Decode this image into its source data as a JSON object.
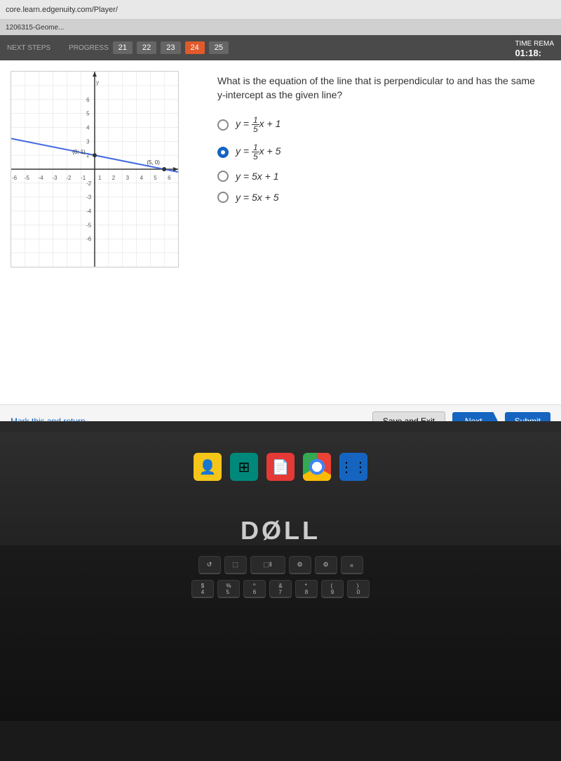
{
  "browser": {
    "url": "core.learn.edgenuity.com/Player/",
    "tab": "1206315-Geome..."
  },
  "header": {
    "nav_label": "NEXT STEPS",
    "progress_label": "PROGRESS",
    "timer_label": "TIME REMA",
    "timer_value": "01:18:",
    "nav_items": [
      "21",
      "22",
      "23",
      "24",
      "25"
    ]
  },
  "question": {
    "text": "What is the equation of the line that is perpendicular to and has the same y-intercept as the given line?",
    "options": [
      {
        "id": "opt1",
        "label": "y = ¹⁄₅x + 1",
        "selected": false
      },
      {
        "id": "opt2",
        "label": "y = ¹⁄₅x + 5",
        "selected": true
      },
      {
        "id": "opt3",
        "label": "y = 5x + 1",
        "selected": false
      },
      {
        "id": "opt4",
        "label": "y = 5x + 5",
        "selected": false
      }
    ],
    "graph": {
      "point1": "(0; 1)",
      "point2": "(5, 0)"
    }
  },
  "footer": {
    "mark_return": "Mark this and return",
    "save_exit": "Save and Exit",
    "next": "Next",
    "submit": "Submit"
  },
  "taskbar": {
    "icons": [
      "👤",
      "⊞",
      "📄",
      "",
      "⋮"
    ]
  },
  "dell": {
    "logo": "DØLL"
  },
  "keyboard": {
    "row1": [
      "↺",
      "⬚",
      "⬚‖",
      "⚙",
      "⚙",
      "«"
    ],
    "row2": [
      "$\n4",
      "%\n5",
      "^\n6",
      "&\n7",
      "*\n8",
      "(\n9",
      ")\n0"
    ]
  }
}
